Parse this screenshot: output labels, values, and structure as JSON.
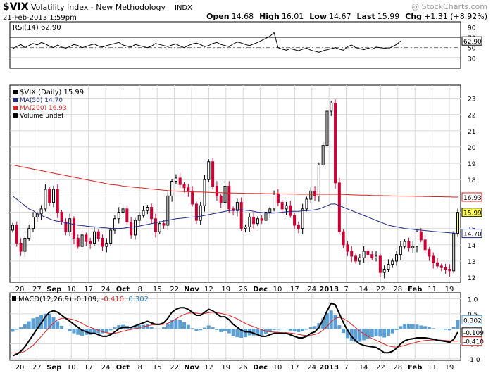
{
  "header": {
    "symbol": "$VIX",
    "name": "Volatility Index - New Methodology",
    "exchange": "INDX",
    "copyright": "@ StockCharts.com",
    "datetime": "21-Feb-2013 1:59pm",
    "quote": {
      "open_label": "Open",
      "open": "14.68",
      "high_label": "High",
      "high": "16.01",
      "low_label": "Low",
      "low": "14.67",
      "last_label": "Last",
      "last": "15.99",
      "chg_label": "Chg",
      "chg": "+1.31 (+8.92%)"
    }
  },
  "colors": {
    "up": "#000000",
    "down": "#cc0033",
    "ma50": "#1f2a8a",
    "ma200": "#dd2222",
    "macd_hist": "#5aa0d6",
    "macd_signal": "#dd2222",
    "last_highlight": "#ffff55",
    "grid": "#d9d9d9"
  },
  "chart_data": [
    {
      "type": "line",
      "panel": "rsi",
      "legend": "RSI(14) 62.90",
      "ylim": [
        10,
        100
      ],
      "yticks": [
        "90",
        "70",
        "50",
        "30"
      ],
      "last_value_label": "62.90",
      "reference_lines": [
        70,
        30
      ],
      "series": [
        {
          "name": "RSI(14)",
          "values": [
            48,
            52,
            56,
            50,
            54,
            58,
            55,
            60,
            57,
            53,
            50,
            55,
            51,
            49,
            52,
            56,
            54,
            50,
            52,
            55,
            57,
            53,
            51,
            54,
            56,
            58,
            60,
            55,
            53,
            51,
            56,
            54,
            52,
            50,
            53,
            58,
            56,
            54,
            52,
            55,
            57,
            53,
            50,
            54,
            57,
            59,
            56,
            52,
            54,
            58,
            60,
            56,
            54,
            52,
            57,
            61,
            59,
            56,
            54,
            57,
            60,
            64,
            68,
            72,
            79,
            50,
            47,
            45,
            48,
            46,
            44,
            47,
            49,
            45,
            43,
            41,
            44,
            46,
            48,
            50,
            47,
            45,
            52,
            55,
            50,
            48,
            46,
            49,
            47,
            51,
            50,
            49,
            48,
            52,
            56,
            62.9
          ]
        }
      ]
    },
    {
      "type": "candlestick",
      "panel": "price",
      "legend": [
        "$VIX (Daily) 15.99",
        "MA(50) 14.70",
        "MA(200) 16.93",
        "Volume undef"
      ],
      "ylim": [
        11.7,
        23.8
      ],
      "yticks": [
        12,
        13,
        14,
        15,
        16,
        17,
        18,
        19,
        20,
        21,
        22,
        23
      ],
      "last_labels": [
        {
          "name": "MA(200)",
          "value": "16.93"
        },
        {
          "name": "$VIX",
          "value": "15.99"
        },
        {
          "name": "MA(50)",
          "value": "14.70"
        }
      ],
      "x_labels": [
        "20",
        "27",
        "Sep",
        "10",
        "17",
        "24",
        "Oct",
        "8",
        "15",
        "22",
        "Nov",
        "12",
        "19",
        "26",
        "Dec",
        "10",
        "17",
        "24",
        "2013",
        "7",
        "14",
        "22",
        "28",
        "Feb",
        "11",
        "19"
      ],
      "closes": [
        15.2,
        14.1,
        13.6,
        14.4,
        15.0,
        15.7,
        15.9,
        16.2,
        17.4,
        16.6,
        17.4,
        16.0,
        15.4,
        14.8,
        15.6,
        14.4,
        13.9,
        14.6,
        14.2,
        14.1,
        14.8,
        14.4,
        13.9,
        14.1,
        14.9,
        15.6,
        16.0,
        16.2,
        15.4,
        14.6,
        15.5,
        15.8,
        16.1,
        16.3,
        15.6,
        14.8,
        15.3,
        15.2,
        17.0,
        17.9,
        18.1,
        17.7,
        17.5,
        17.3,
        16.5,
        15.5,
        16.4,
        18.0,
        19.1,
        17.6,
        17.0,
        16.6,
        17.6,
        16.2,
        16.1,
        16.6,
        15.0,
        15.1,
        15.7,
        15.3,
        15.6,
        15.5,
        16.0,
        16.2,
        17.1,
        16.6,
        16.2,
        16.4,
        15.8,
        15.2,
        15.0,
        16.2,
        16.8,
        17.3,
        17.0,
        18.9,
        20.1,
        22.2,
        22.7,
        17.8,
        14.8,
        14.0,
        13.6,
        13.3,
        13.0,
        13.2,
        13.6,
        13.4,
        13.2,
        13.3,
        12.3,
        12.5,
        12.8,
        13.0,
        13.4,
        13.9,
        14.2,
        13.8,
        13.9,
        14.8,
        14.3,
        13.7,
        13.3,
        12.9,
        12.7,
        12.6,
        12.5,
        12.4,
        14.7,
        15.99
      ],
      "ma50": [
        17.0,
        16.8,
        16.6,
        16.4,
        16.2,
        16.1,
        15.9,
        15.8,
        15.7,
        15.6,
        15.5,
        15.45,
        15.4,
        15.35,
        15.3,
        15.25,
        15.2,
        15.18,
        15.15,
        15.12,
        15.1,
        15.08,
        15.05,
        15.03,
        15.0,
        15.0,
        15.0,
        15.02,
        15.05,
        15.08,
        15.1,
        15.15,
        15.2,
        15.25,
        15.3,
        15.35,
        15.4,
        15.45,
        15.5,
        15.55,
        15.6,
        15.62,
        15.65,
        15.68,
        15.7,
        15.72,
        15.75,
        15.8,
        15.85,
        15.9,
        15.95,
        16.0,
        16.05,
        16.1,
        16.12,
        16.15,
        16.15,
        16.12,
        16.1,
        16.05,
        16.0,
        15.98,
        15.95,
        15.95,
        15.95,
        15.97,
        16.0,
        16.02,
        16.05,
        16.05,
        16.05,
        16.08,
        16.1,
        16.12,
        16.15,
        16.2,
        16.3,
        16.4,
        16.5,
        16.5,
        16.4,
        16.3,
        16.2,
        16.1,
        16.0,
        15.9,
        15.8,
        15.7,
        15.6,
        15.5,
        15.4,
        15.3,
        15.2,
        15.15,
        15.1,
        15.05,
        15.0,
        14.97,
        14.95,
        14.92,
        14.9,
        14.87,
        14.85,
        14.82,
        14.8,
        14.78,
        14.76,
        14.74,
        14.72,
        14.7
      ],
      "ma200": [
        18.9,
        18.85,
        18.8,
        18.75,
        18.7,
        18.65,
        18.6,
        18.55,
        18.5,
        18.45,
        18.4,
        18.35,
        18.3,
        18.25,
        18.2,
        18.15,
        18.1,
        18.05,
        18.0,
        17.95,
        17.9,
        17.85,
        17.8,
        17.75,
        17.7,
        17.68,
        17.65,
        17.6,
        17.58,
        17.55,
        17.52,
        17.5,
        17.48,
        17.45,
        17.42,
        17.4,
        17.38,
        17.35,
        17.33,
        17.3,
        17.29,
        17.28,
        17.27,
        17.26,
        17.25,
        17.24,
        17.24,
        17.23,
        17.22,
        17.21,
        17.2,
        17.2,
        17.19,
        17.18,
        17.18,
        17.17,
        17.17,
        17.16,
        17.16,
        17.15,
        17.15,
        17.15,
        17.14,
        17.14,
        17.13,
        17.13,
        17.12,
        17.12,
        17.11,
        17.11,
        17.1,
        17.1,
        17.1,
        17.1,
        17.1,
        17.1,
        17.1,
        17.1,
        17.1,
        17.1,
        17.1,
        17.09,
        17.08,
        17.07,
        17.06,
        17.05,
        17.05,
        17.04,
        17.03,
        17.02,
        17.02,
        17.01,
        17.01,
        17.0,
        17.0,
        16.99,
        16.99,
        16.98,
        16.98,
        16.97,
        16.97,
        16.96,
        16.96,
        16.95,
        16.95,
        16.95,
        16.94,
        16.94,
        16.93,
        16.93
      ]
    },
    {
      "type": "line",
      "panel": "macd",
      "legend": {
        "prefix": "MACD(12,26,9) ",
        "macd": "-0.109",
        "signal": "-0.410",
        "hist": "0.302"
      },
      "ylim": [
        -1.05,
        1.2
      ],
      "yticks": [
        "1.0",
        "0.5",
        "-0.5",
        "-1.0"
      ],
      "last_labels": [
        {
          "name": "hist",
          "value": "0.302"
        },
        {
          "name": "macd",
          "value": "-0.109"
        },
        {
          "name": "signal",
          "value": "-0.410"
        }
      ],
      "x_labels": [
        "20",
        "27",
        "Sep",
        "10",
        "17",
        "24",
        "Oct",
        "8",
        "15",
        "22",
        "Nov",
        "12",
        "19",
        "26",
        "Dec",
        "10",
        "17",
        "24",
        "2013",
        "7",
        "14",
        "22",
        "28",
        "Feb",
        "11",
        "19"
      ],
      "series": [
        {
          "name": "MACD",
          "values": [
            -0.9,
            -0.85,
            -0.75,
            -0.6,
            -0.4,
            -0.2,
            0.0,
            0.2,
            0.4,
            0.55,
            0.6,
            0.55,
            0.45,
            0.35,
            0.25,
            0.15,
            0.05,
            -0.05,
            -0.1,
            -0.15,
            -0.15,
            -0.2,
            -0.25,
            -0.25,
            -0.2,
            -0.1,
            0.0,
            0.05,
            0.05,
            0.05,
            0.1,
            0.15,
            0.2,
            0.25,
            0.2,
            0.15,
            0.15,
            0.2,
            0.35,
            0.55,
            0.65,
            0.7,
            0.7,
            0.65,
            0.55,
            0.45,
            0.45,
            0.55,
            0.65,
            0.6,
            0.5,
            0.4,
            0.4,
            0.3,
            0.15,
            0.05,
            -0.05,
            -0.1,
            -0.1,
            -0.15,
            -0.2,
            -0.25,
            -0.25,
            -0.2,
            -0.15,
            -0.15,
            -0.15,
            -0.15,
            -0.2,
            -0.25,
            -0.3,
            -0.3,
            -0.25,
            -0.15,
            -0.1,
            0.05,
            0.3,
            0.6,
            0.85,
            0.8,
            0.5,
            0.2,
            -0.05,
            -0.25,
            -0.4,
            -0.5,
            -0.55,
            -0.58,
            -0.6,
            -0.62,
            -0.7,
            -0.8,
            -0.8,
            -0.75,
            -0.65,
            -0.5,
            -0.4,
            -0.35,
            -0.33,
            -0.3,
            -0.3,
            -0.3,
            -0.32,
            -0.35,
            -0.38,
            -0.4,
            -0.42,
            -0.45,
            -0.35,
            -0.109
          ]
        },
        {
          "name": "Signal",
          "values": [
            -0.8,
            -0.82,
            -0.8,
            -0.75,
            -0.65,
            -0.55,
            -0.4,
            -0.25,
            -0.1,
            0.05,
            0.2,
            0.3,
            0.35,
            0.35,
            0.33,
            0.3,
            0.25,
            0.18,
            0.1,
            0.05,
            0.0,
            -0.05,
            -0.1,
            -0.13,
            -0.15,
            -0.15,
            -0.12,
            -0.08,
            -0.05,
            -0.02,
            0.0,
            0.03,
            0.07,
            0.1,
            0.13,
            0.14,
            0.14,
            0.15,
            0.18,
            0.25,
            0.33,
            0.41,
            0.48,
            0.52,
            0.53,
            0.52,
            0.5,
            0.51,
            0.54,
            0.55,
            0.54,
            0.51,
            0.48,
            0.45,
            0.39,
            0.33,
            0.25,
            0.18,
            0.12,
            0.07,
            0.02,
            -0.03,
            -0.08,
            -0.1,
            -0.11,
            -0.12,
            -0.13,
            -0.13,
            -0.14,
            -0.16,
            -0.19,
            -0.21,
            -0.22,
            -0.21,
            -0.19,
            -0.14,
            -0.05,
            0.08,
            0.24,
            0.35,
            0.38,
            0.34,
            0.26,
            0.15,
            0.04,
            -0.07,
            -0.17,
            -0.25,
            -0.32,
            -0.38,
            -0.44,
            -0.51,
            -0.57,
            -0.6,
            -0.61,
            -0.59,
            -0.55,
            -0.51,
            -0.48,
            -0.44,
            -0.41,
            -0.39,
            -0.38,
            -0.37,
            -0.37,
            -0.38,
            -0.39,
            -0.4,
            -0.41,
            -0.41
          ]
        }
      ]
    }
  ]
}
